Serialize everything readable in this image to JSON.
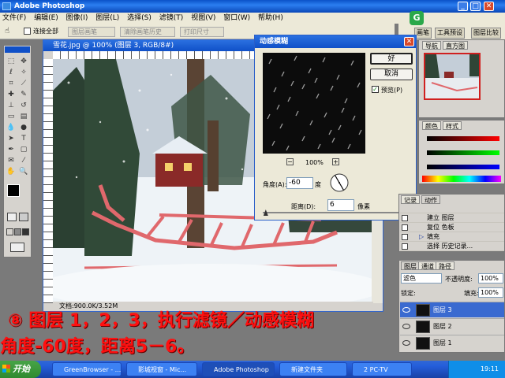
{
  "app": {
    "title": "Adobe Photoshop"
  },
  "menu": [
    "文件(F)",
    "编辑(E)",
    "图像(I)",
    "图层(L)",
    "选择(S)",
    "滤镜(T)",
    "视图(V)",
    "窗口(W)",
    "帮助(H)"
  ],
  "options": {
    "select_all": "连接全部",
    "btn1": "图层画笔",
    "btn2": "清除画笔历史",
    "btn3": "打印尺寸"
  },
  "palette_well": {
    "tabs": [
      "画笔",
      "工具预设",
      "图层比较"
    ]
  },
  "document": {
    "title": "雪花.jpg @ 100% (图层 3, RGB/8#)",
    "status": "文档:900.0K/3.52M"
  },
  "dialog": {
    "title": "动感模糊",
    "ok": "好",
    "cancel": "取消",
    "preview_label": "预览(P)",
    "zoom": "100%",
    "angle_label": "角度(A):",
    "angle_value": "-60",
    "angle_unit": "度",
    "distance_label": "距离(D):",
    "distance_value": "6",
    "distance_unit": "像素",
    "distance_fraction": 0.02
  },
  "navigator": {
    "tabs": [
      "导航",
      "直方图"
    ]
  },
  "color_panel": {
    "tabs": [
      "颜色",
      "样式"
    ]
  },
  "actions_panel": {
    "tabs": [
      "记录",
      "动作"
    ],
    "items": [
      "建立 图层",
      "复位 色板",
      "填充",
      "选择 历史记录..."
    ]
  },
  "layers_panel": {
    "tabs": [
      "图层",
      "通道",
      "路径"
    ],
    "blend_mode": "滤色",
    "opacity_label": "不透明度:",
    "opacity": "100%",
    "lock_label": "锁定:",
    "fill_label": "填充:",
    "fill": "100%",
    "layers": [
      "图层 3",
      "图层 2",
      "图层 1"
    ]
  },
  "captions": {
    "line1": "⑧ 图层 1，2，3，执行滤镜／动感模糊",
    "line2": "角度-60度，距离5－6。"
  },
  "taskbar": {
    "start": "开始",
    "tasks": [
      "GreenBrowser - ...",
      "影城视窗 - Mic...",
      "Adobe Photoshop",
      "新建文件夹",
      "2 PC-TV"
    ],
    "clock": "19:11"
  },
  "colors": {
    "caption_red": "#ff1010",
    "xp_blue": "#245edb",
    "start_green": "#2f8a2f"
  }
}
